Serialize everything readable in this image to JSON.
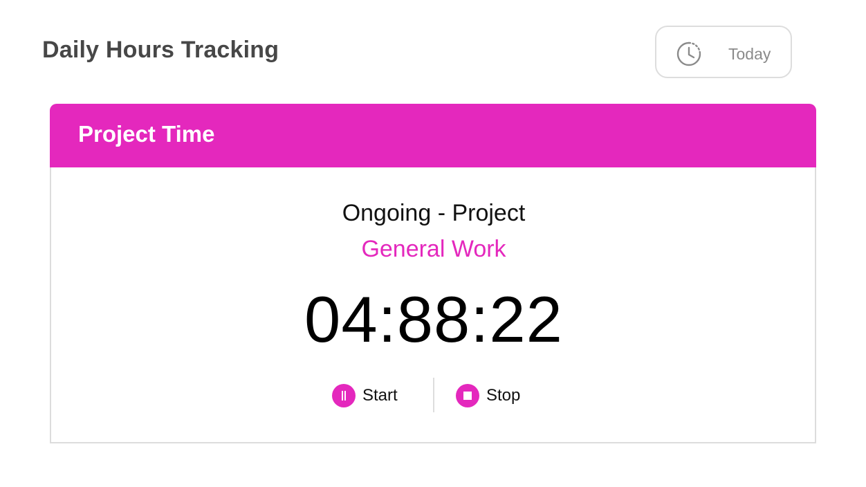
{
  "header": {
    "title": "Daily Hours Tracking",
    "date_filter": {
      "icon": "clock-history-icon",
      "label": "Today"
    }
  },
  "card": {
    "title": "Project Time",
    "project": "Ongoing - Project",
    "task": "General Work",
    "timer": "04:88:22",
    "start_label": "Start",
    "start_icon": "pause-icon",
    "stop_label": "Stop",
    "stop_icon": "stop-icon"
  },
  "colors": {
    "accent": "#e428bd",
    "title_text": "#474747",
    "border": "#dddddd",
    "muted_text": "#8a8a8a"
  }
}
